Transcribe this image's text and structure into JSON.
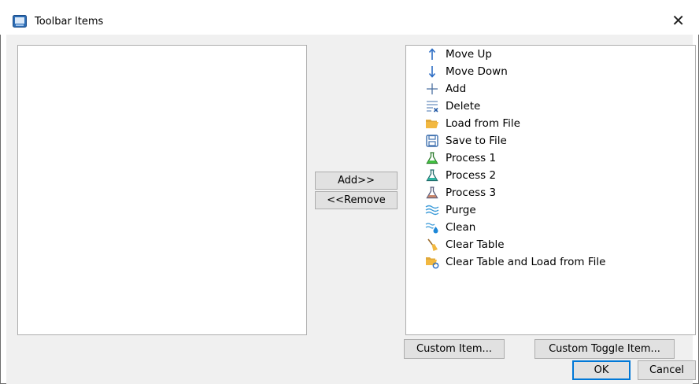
{
  "window": {
    "title": "Toolbar Items"
  },
  "buttons": {
    "add": "Add>>",
    "remove": "<<Remove",
    "custom_item": "Custom Item...",
    "custom_toggle": "Custom Toggle Item...",
    "ok": "OK",
    "cancel": "Cancel"
  },
  "available_items": [
    {
      "label": "Move Up",
      "icon": "arrow-up-icon"
    },
    {
      "label": "Move Down",
      "icon": "arrow-down-icon"
    },
    {
      "label": "Add",
      "icon": "plus-icon"
    },
    {
      "label": "Delete",
      "icon": "delete-list-icon"
    },
    {
      "label": "Load from File",
      "icon": "open-folder-icon"
    },
    {
      "label": "Save to File",
      "icon": "floppy-disk-icon"
    },
    {
      "label": "Process 1",
      "icon": "flask-green-icon"
    },
    {
      "label": "Process 2",
      "icon": "flask-teal-icon"
    },
    {
      "label": "Process 3",
      "icon": "flask-brown-icon"
    },
    {
      "label": "Purge",
      "icon": "waves-icon"
    },
    {
      "label": "Clean",
      "icon": "water-drop-icon"
    },
    {
      "label": "Clear Table",
      "icon": "broom-icon"
    },
    {
      "label": "Clear Table and Load from File",
      "icon": "folder-refresh-icon"
    }
  ],
  "selected_items": []
}
